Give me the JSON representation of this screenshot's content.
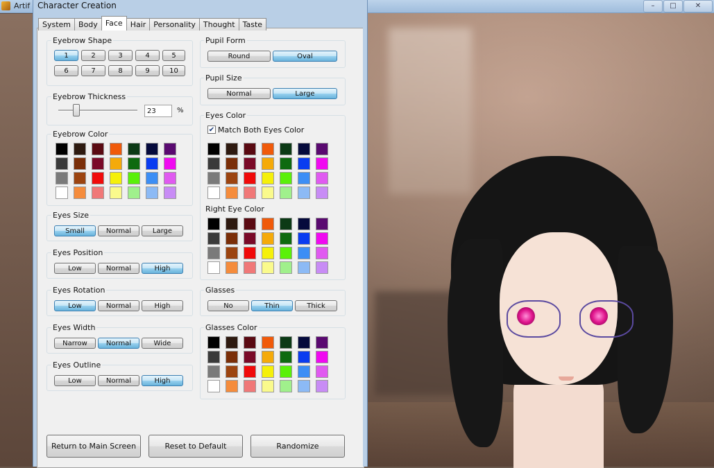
{
  "app_window": {
    "title": "Artif",
    "min_icon": "minimize-icon",
    "max_icon": "maximize-icon",
    "close_icon": "close-icon",
    "min_glyph": "–",
    "max_glyph": "□",
    "close_glyph": "✕"
  },
  "dialog": {
    "title": "Character Creation",
    "tabs": [
      "System",
      "Body",
      "Face",
      "Hair",
      "Personality",
      "Thought",
      "Taste"
    ],
    "active_tab": "Face"
  },
  "eyebrow_shape": {
    "label": "Eyebrow Shape",
    "options": [
      "1",
      "2",
      "3",
      "4",
      "5",
      "6",
      "7",
      "8",
      "9",
      "10"
    ],
    "selected": "1"
  },
  "eyebrow_thickness": {
    "label": "Eyebrow Thickness",
    "value": "23",
    "unit": "%",
    "fraction": 0.23
  },
  "eyebrow_color": {
    "label": "Eyebrow Color"
  },
  "eyes_size": {
    "label": "Eyes Size",
    "options": [
      "Small",
      "Normal",
      "Large"
    ],
    "selected": "Small"
  },
  "eyes_position": {
    "label": "Eyes Position",
    "options": [
      "Low",
      "Normal",
      "High"
    ],
    "selected": "High"
  },
  "eyes_rotation": {
    "label": "Eyes Rotation",
    "options": [
      "Low",
      "Normal",
      "High"
    ],
    "selected": "Low"
  },
  "eyes_width": {
    "label": "Eyes Width",
    "options": [
      "Narrow",
      "Normal",
      "Wide"
    ],
    "selected": "Normal"
  },
  "eyes_outline": {
    "label": "Eyes Outline",
    "options": [
      "Low",
      "Normal",
      "High"
    ],
    "selected": "High"
  },
  "pupil_form": {
    "label": "Pupil Form",
    "options": [
      "Round",
      "Oval"
    ],
    "selected": "Oval"
  },
  "pupil_size": {
    "label": "Pupil Size",
    "options": [
      "Normal",
      "Large"
    ],
    "selected": "Large"
  },
  "eyes_color": {
    "label": "Eyes Color",
    "match_label": "Match Both Eyes Color",
    "match_checked": true,
    "check_glyph": "✔"
  },
  "right_eye_color": {
    "label": "Right Eye Color"
  },
  "glasses": {
    "label": "Glasses",
    "options": [
      "No",
      "Thin",
      "Thick"
    ],
    "selected": "Thin"
  },
  "glasses_color": {
    "label": "Glasses Color"
  },
  "footer": {
    "return_label": "Return to Main Screen",
    "reset_label": "Reset to Default",
    "randomize_label": "Randomize"
  },
  "palette_colors": [
    [
      "#000000",
      "#2e1a10",
      "#5a0a12",
      "#f05a0a",
      "#0c3a16",
      "#050a3c",
      "#5a0a70"
    ],
    [
      "#3a3a3a",
      "#7a2e08",
      "#7a0a28",
      "#f5aa0a",
      "#0e6a10",
      "#0a3cf0",
      "#f00af0"
    ],
    [
      "#7a7a7a",
      "#9c4410",
      "#f00a0a",
      "#f5f00a",
      "#5af00a",
      "#3c8ef5",
      "#e05af0"
    ],
    [
      "#ffffff",
      "#f58c3c",
      "#f07878",
      "#fafa8c",
      "#a0f08c",
      "#8cbaf5",
      "#c88cf5"
    ]
  ]
}
